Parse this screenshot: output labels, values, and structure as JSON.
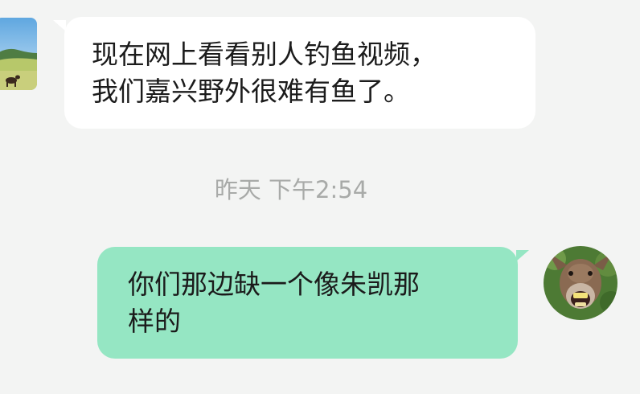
{
  "chat": {
    "messages": [
      {
        "direction": "incoming",
        "text": "现在网上看看别人钓鱼视频，\n我们嘉兴野外很难有鱼了。"
      },
      {
        "direction": "outgoing",
        "text": "你们那边缺一个像朱凯那\n样的"
      }
    ],
    "timestamp": "昨天 下午2:54"
  },
  "colors": {
    "background": "#f3f4f3",
    "incoming_bubble": "#ffffff",
    "outgoing_bubble": "#95e6c3",
    "timestamp_text": "#a8aaa8"
  },
  "icons": {
    "left_avatar": "landscape-avatar-icon",
    "right_avatar": "donkey-avatar-icon"
  }
}
